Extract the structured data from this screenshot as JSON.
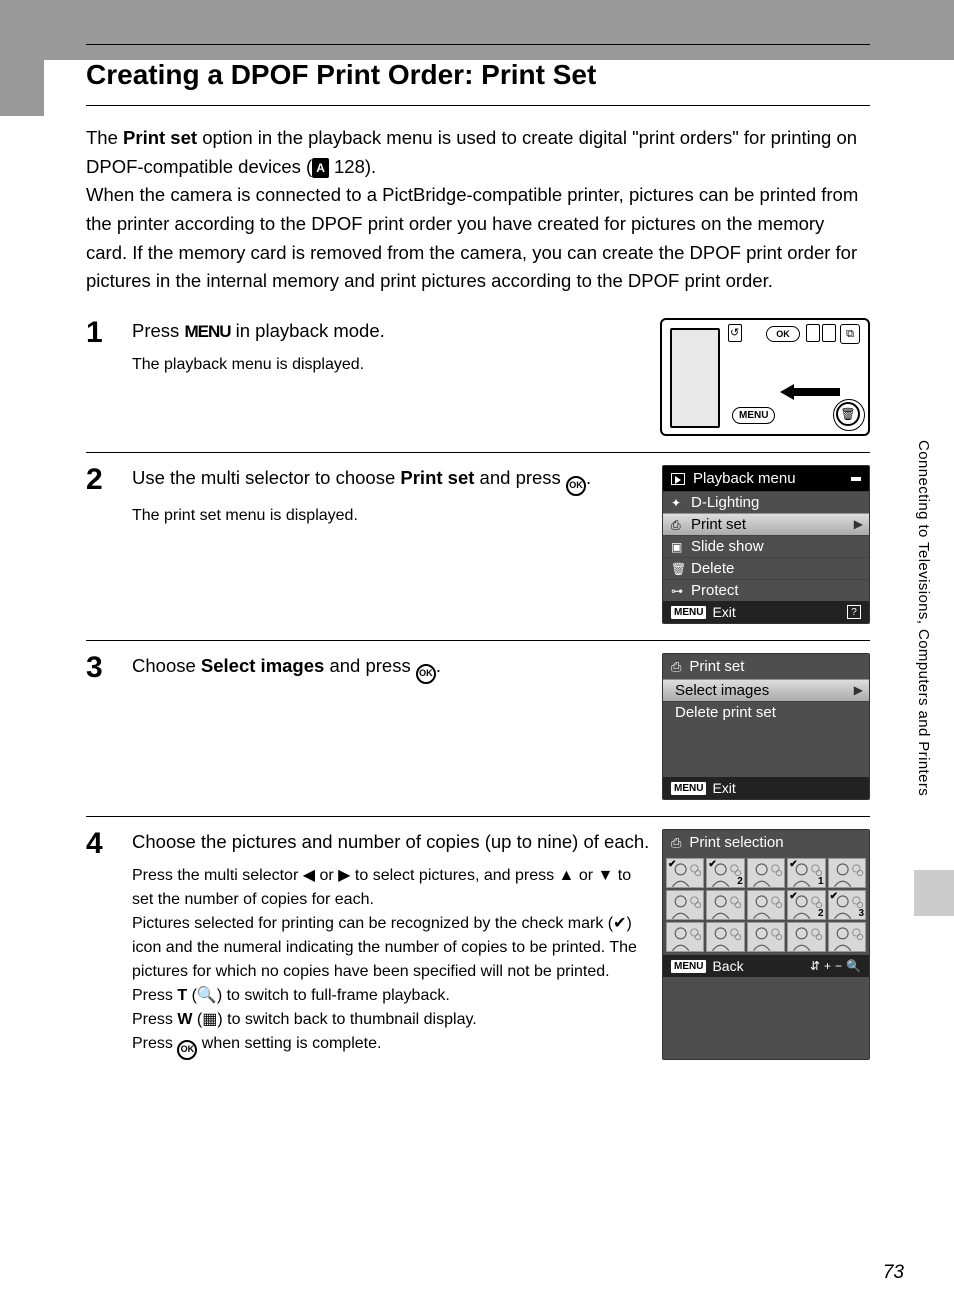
{
  "side_tab": "Connecting to Televisions, Computers and Printers",
  "title": "Creating a DPOF Print Order: Print Set",
  "intro": {
    "p1a": "The ",
    "p1b": "Print set",
    "p1c": " option in the playback menu is used to create digital \"print orders\" for printing on DPOF-compatible devices (",
    "p1_ref": "128",
    "p1d": ").",
    "p2": "When the camera is connected to a PictBridge-compatible printer, pictures can be printed from the printer according to the DPOF print order you have created for pictures on the memory card. If the memory card is removed from the camera, you can create the DPOF print order for pictures in the internal memory and print pictures according to the DPOF print order."
  },
  "steps": [
    {
      "num": "1",
      "heading_a": "Press ",
      "heading_menu": "MENU",
      "heading_b": " in playback mode.",
      "sub": "The playback menu is displayed.",
      "cam": {
        "ok": "OK",
        "menu": "MENU"
      }
    },
    {
      "num": "2",
      "heading_a": "Use the multi selector to choose ",
      "heading_bold": "Print set",
      "heading_b": " and press ",
      "heading_ok": "OK",
      "heading_c": ".",
      "sub": "The print set menu is displayed.",
      "lcd": {
        "title": "Playback menu",
        "rows": [
          {
            "icon": "✦",
            "label": "D-Lighting"
          },
          {
            "icon": "⎙",
            "label": "Print set",
            "selected": true
          },
          {
            "icon": "▣",
            "label": "Slide show"
          },
          {
            "icon": "🗑",
            "label": "Delete"
          },
          {
            "icon": "⊶",
            "label": "Protect"
          }
        ],
        "footer": "Exit",
        "help": "?"
      }
    },
    {
      "num": "3",
      "heading_a": "Choose ",
      "heading_bold": "Select images",
      "heading_b": " and press ",
      "heading_ok": "OK",
      "heading_c": ".",
      "lcd": {
        "title": "Print set",
        "title_icon": "⎙",
        "rows": [
          {
            "label": "Select images",
            "selected": true
          },
          {
            "label": "Delete print set"
          }
        ],
        "footer": "Exit"
      }
    },
    {
      "num": "4",
      "heading_a": "Choose the pictures and number of copies (up to nine) of each.",
      "sub_parts": {
        "a": "Press the multi selector ◀ or ▶ to select pictures, and press ▲ or ▼ to set the number of copies for each.",
        "b": "Pictures selected for printing can be recognized by the check mark (✔) icon and the numeral indicating the number of copies to be printed. The pictures for which no copies have been specified will not be printed.",
        "c_pre": "Press ",
        "c_T": "T",
        "c_mid": " (🔍) to switch to full-frame playback.",
        "d_pre": "Press ",
        "d_W": "W",
        "d_mid": " (▦) to switch back to thumbnail display.",
        "e_pre": "Press ",
        "e_ok": "OK",
        "e_post": " when setting is complete."
      },
      "lcd": {
        "title": "Print selection",
        "title_icon": "⎙",
        "thumbs": [
          {
            "chk": "✔",
            "n": ""
          },
          {
            "chk": "✔",
            "n": "2"
          },
          {
            "chk": "",
            "n": ""
          },
          {
            "chk": "✔",
            "n": "1"
          },
          {
            "chk": "",
            "n": ""
          },
          {
            "chk": "",
            "n": ""
          },
          {
            "chk": "",
            "n": ""
          },
          {
            "chk": "",
            "n": ""
          },
          {
            "chk": "✔",
            "n": "2"
          },
          {
            "chk": "✔",
            "n": "3"
          },
          {
            "chk": "",
            "n": ""
          },
          {
            "chk": "",
            "n": ""
          },
          {
            "chk": "",
            "n": ""
          },
          {
            "chk": "",
            "n": ""
          },
          {
            "chk": "",
            "n": ""
          }
        ],
        "footer": "Back",
        "ctrl_updown": "⇵",
        "ctrl_plus": "+",
        "ctrl_minus": "−",
        "ctrl_zoom": "🔍"
      }
    }
  ],
  "page_number": "73"
}
